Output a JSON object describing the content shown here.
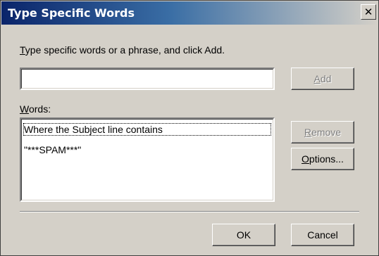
{
  "window": {
    "title": "Type Specific Words",
    "close_label": "x"
  },
  "instructions": {
    "prefix_underlined": "T",
    "rest": "ype specific words or a phrase, and click Add."
  },
  "word_input": {
    "value": "",
    "placeholder": ""
  },
  "buttons": {
    "add": {
      "underlined": "A",
      "rest": "dd",
      "enabled": false
    },
    "remove": {
      "underlined": "R",
      "rest": "emove",
      "enabled": false
    },
    "options": {
      "underlined": "O",
      "rest": "ptions...",
      "enabled": true
    },
    "ok": {
      "label": "OK"
    },
    "cancel": {
      "label": "Cancel"
    }
  },
  "words_label": {
    "underlined": "W",
    "rest": "ords:"
  },
  "words_list": {
    "items": [
      {
        "text": "Where the Subject line contains",
        "selected": true
      },
      {
        "text": "\"***SPAM***\"",
        "selected": false
      }
    ]
  }
}
